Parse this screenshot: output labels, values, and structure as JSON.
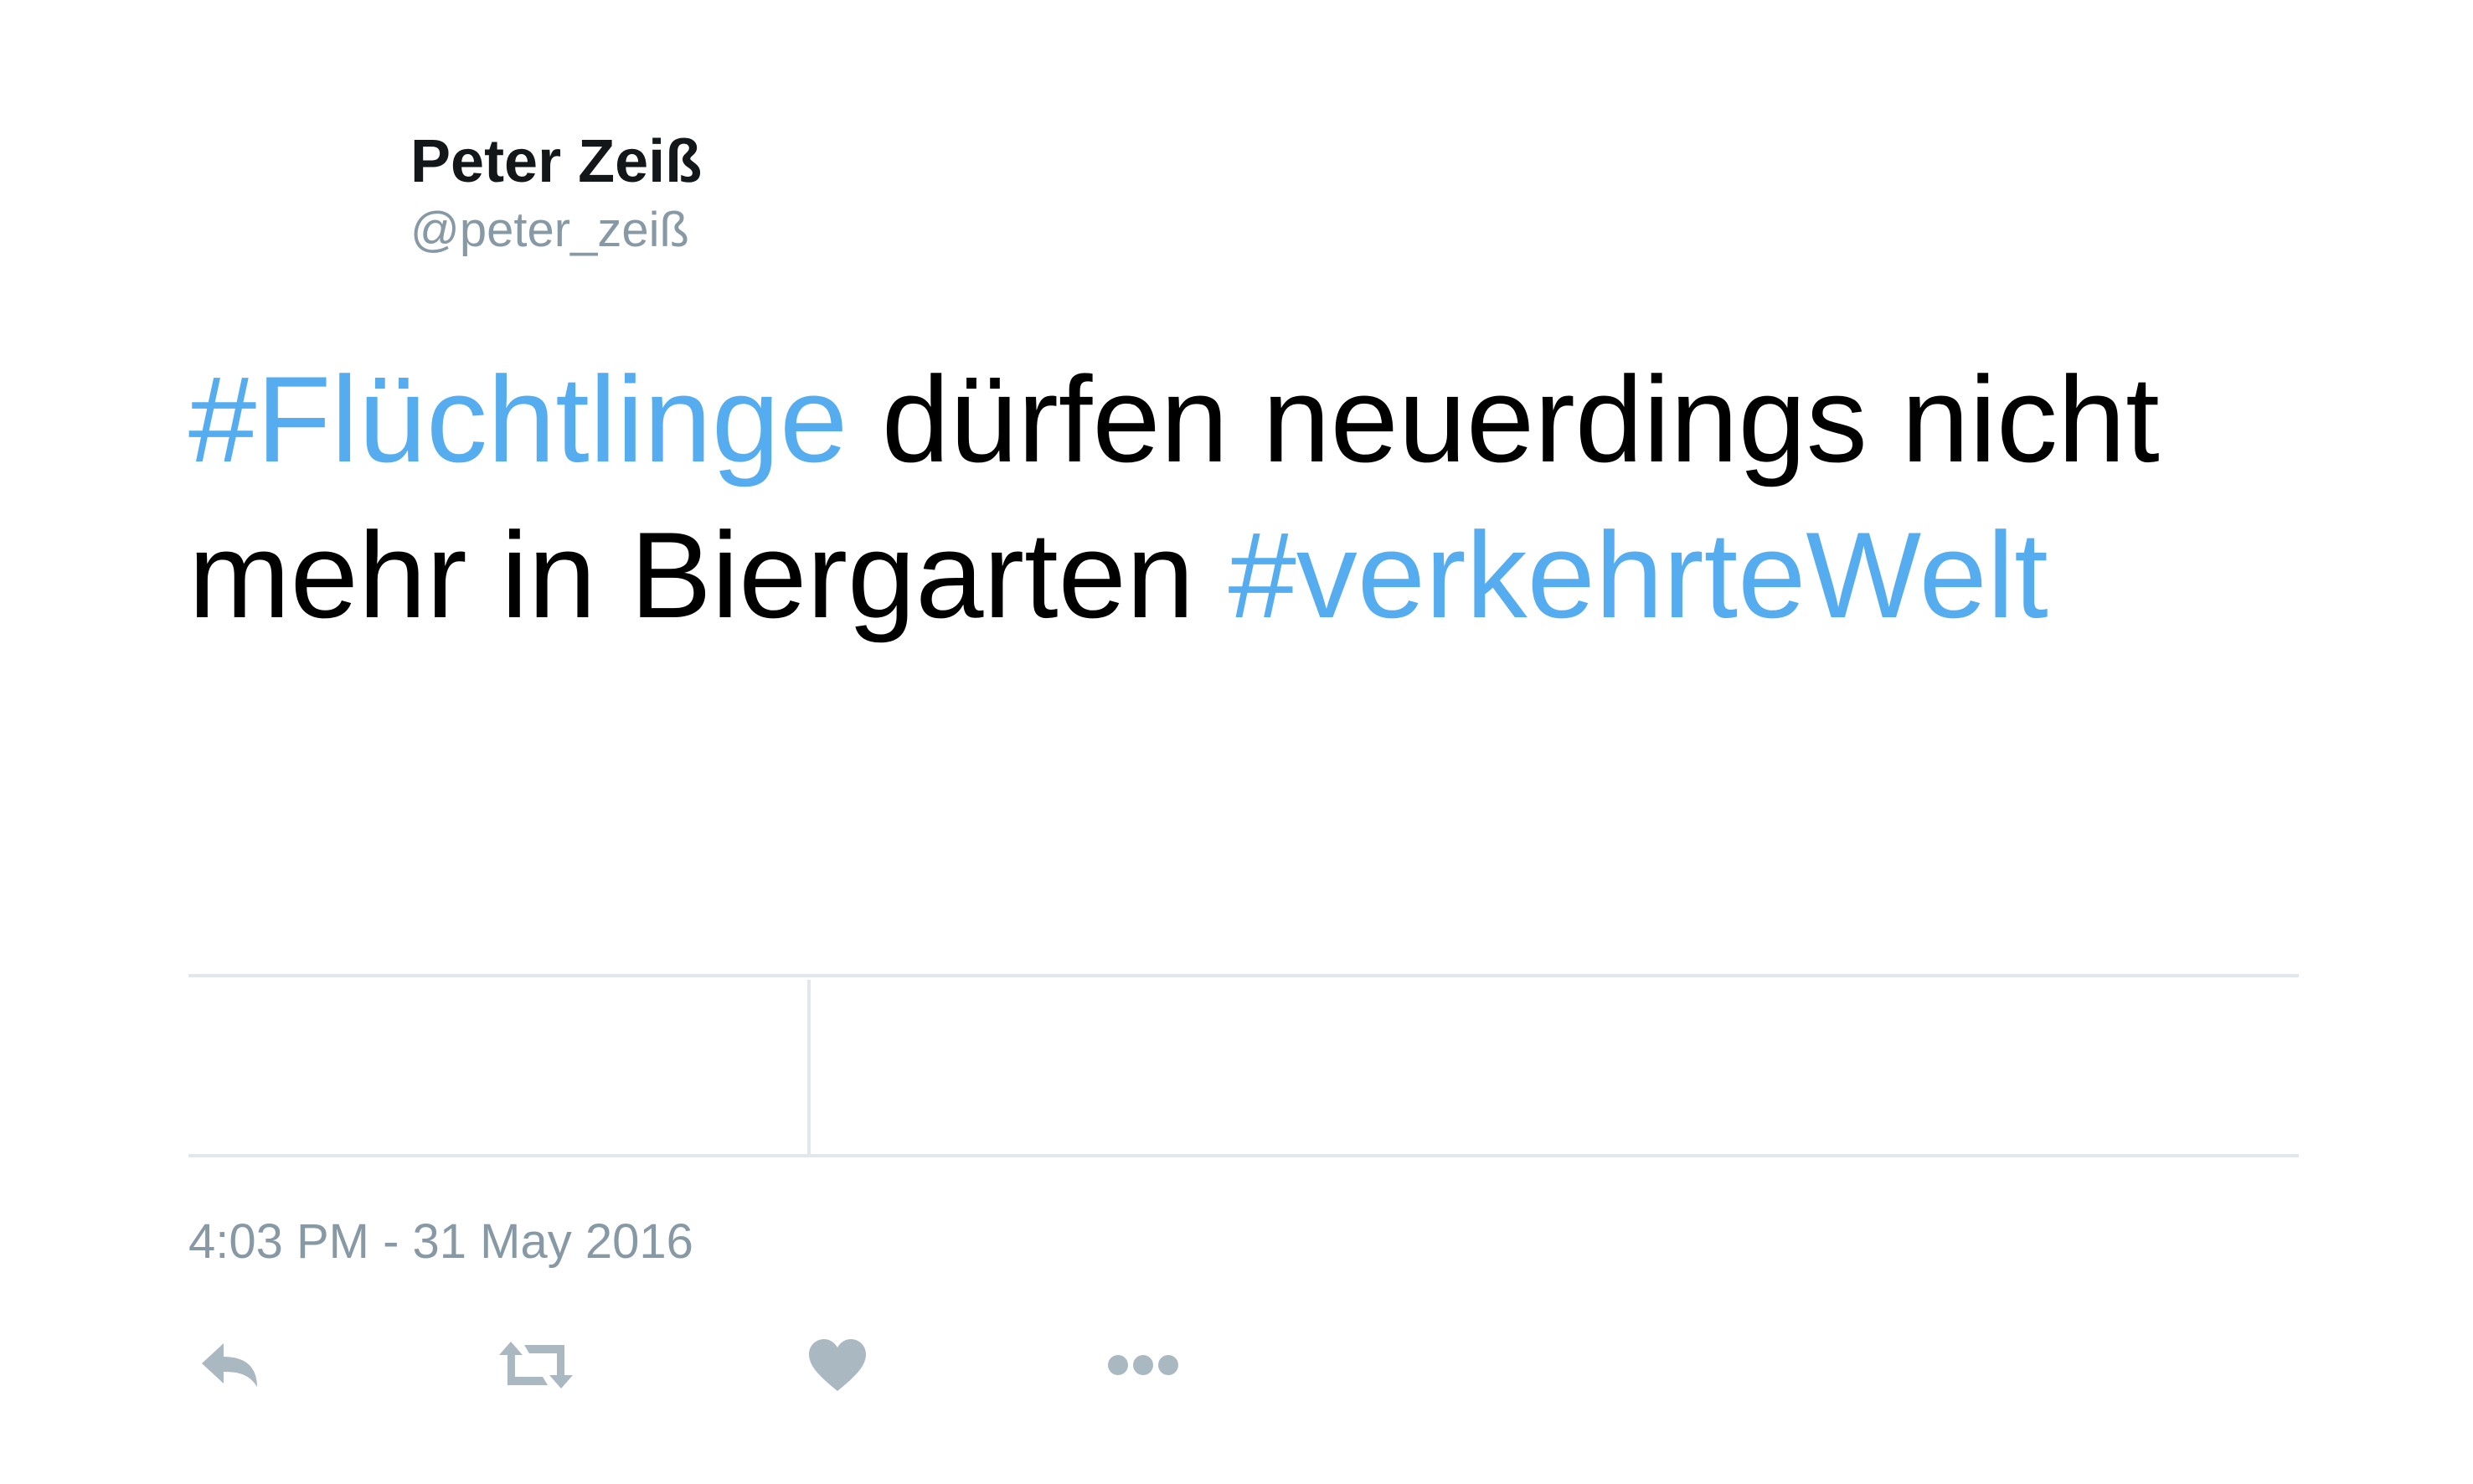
{
  "user": {
    "name": "Peter Zeiß",
    "handle": "@peter_zeiß"
  },
  "tweet": {
    "segments": [
      {
        "text": "#Flüchtlinge",
        "hashtag": true
      },
      {
        "text": " dürfen neuerdings nicht mehr in Biergarten ",
        "hashtag": false
      },
      {
        "text": "#verkehrteWelt",
        "hashtag": true
      }
    ],
    "timestamp": "4:03 PM - 31 May 2016"
  },
  "actions": [
    {
      "icon": "reply-icon"
    },
    {
      "icon": "retweet-icon"
    },
    {
      "icon": "heart-icon"
    },
    {
      "icon": "more-icon"
    }
  ],
  "colors": {
    "hashtag": "#55acee",
    "secondary_text": "#8899a6",
    "icon": "#aab8c2",
    "divider": "#e1e8ed"
  }
}
